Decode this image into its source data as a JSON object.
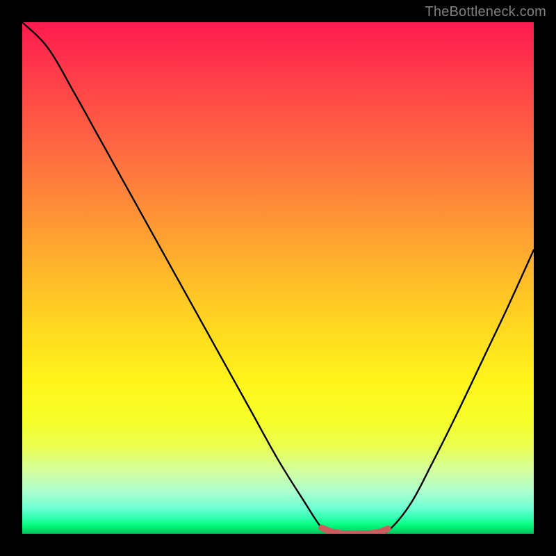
{
  "watermark": {
    "text": "TheBottleneck.com"
  },
  "chart_data": {
    "type": "line",
    "title": "",
    "xlabel": "",
    "ylabel": "",
    "xlim": [
      0,
      1
    ],
    "ylim": [
      0,
      1
    ],
    "series": [
      {
        "name": "curve",
        "x": [
          0.0,
          0.05,
          0.1,
          0.15,
          0.2,
          0.25,
          0.3,
          0.35,
          0.4,
          0.45,
          0.5,
          0.55,
          0.585,
          0.605,
          0.65,
          0.7,
          0.72,
          0.76,
          0.8,
          0.85,
          0.9,
          0.95,
          1.0
        ],
        "values": [
          1.0,
          0.95,
          0.865,
          0.775,
          0.685,
          0.595,
          0.505,
          0.415,
          0.325,
          0.235,
          0.145,
          0.065,
          0.012,
          0.002,
          0.0,
          0.002,
          0.01,
          0.06,
          0.135,
          0.235,
          0.34,
          0.445,
          0.555
        ]
      },
      {
        "name": "valley-marker",
        "x": [
          0.585,
          0.605,
          0.625,
          0.64,
          0.66,
          0.68,
          0.7,
          0.715
        ],
        "values": [
          0.012,
          0.004,
          0.001,
          0.0,
          0.0,
          0.001,
          0.004,
          0.01
        ]
      }
    ],
    "annotations": [],
    "colors": {
      "curve": "#000000",
      "valley_marker": "#cd5c5c",
      "gradient_top": "#ff1a4f",
      "gradient_bottom": "#00c45d"
    }
  }
}
